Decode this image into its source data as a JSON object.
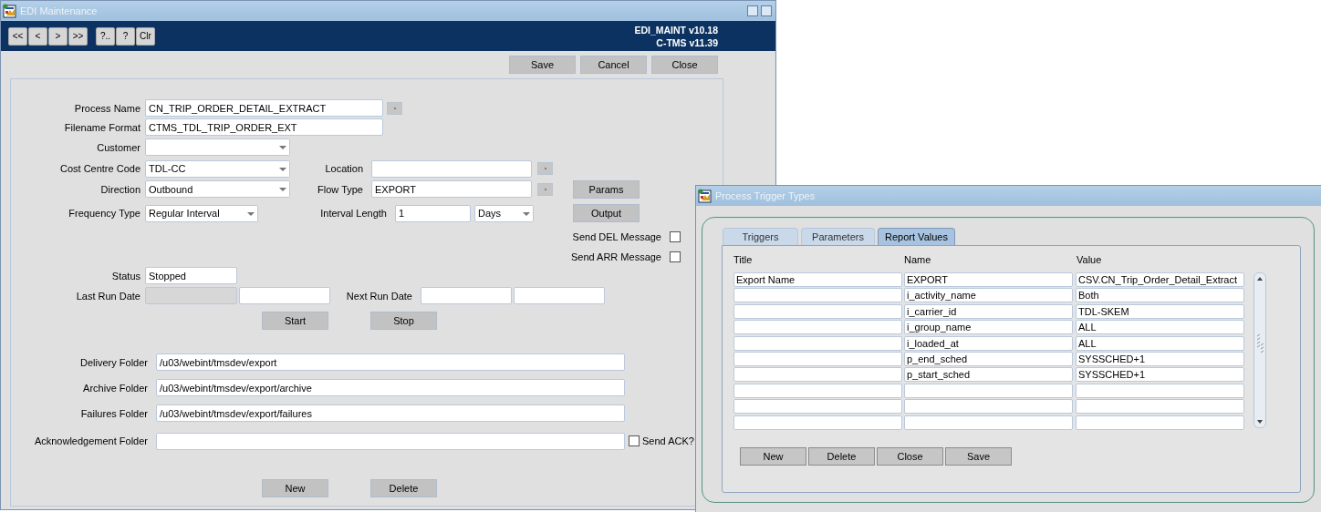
{
  "main_window": {
    "title": "EDI Maintenance",
    "toolbar_buttons": [
      "<<",
      "<",
      ">",
      ">>",
      "?..",
      "?",
      "Clr"
    ],
    "version_lines": [
      "EDI_MAINT v10.18",
      "C-TMS v11.39"
    ],
    "action_buttons": [
      "Save",
      "Cancel",
      "Close"
    ],
    "form": {
      "process_name": {
        "label": "Process Name",
        "value": "CN_TRIP_ORDER_DETAIL_EXTRACT"
      },
      "filename_format": {
        "label": "Filename Format",
        "value": "CTMS_TDL_TRIP_ORDER_EXT"
      },
      "customer": {
        "label": "Customer"
      },
      "cost_centre_code": {
        "label": "Cost Centre Code",
        "value": "TDL-CC"
      },
      "location": {
        "label": "Location"
      },
      "direction": {
        "label": "Direction",
        "value": "Outbound"
      },
      "flow_type": {
        "label": "Flow Type",
        "value": "EXPORT"
      },
      "params_button": "Params",
      "frequency_type": {
        "label": "Frequency Type",
        "value": "Regular Interval"
      },
      "interval_length": {
        "label": "Interval Length",
        "value": "1",
        "unit": "Days"
      },
      "output_button": "Output",
      "send_del_message": {
        "label": "Send DEL Message",
        "checked": false
      },
      "send_arr_message": {
        "label": "Send ARR Message",
        "checked": false
      },
      "status": {
        "label": "Status",
        "value": "Stopped"
      },
      "last_run_date": {
        "label": "Last Run Date",
        "fields": [
          {
            "disabled": true
          },
          {
            "disabled": false
          }
        ]
      },
      "next_run_date": {
        "label": "Next Run Date"
      },
      "run_buttons": [
        "Start",
        "Stop"
      ],
      "delivery_folder": {
        "label": "Delivery Folder",
        "value": "/u03/webint/tmsdev/export"
      },
      "archive_folder": {
        "label": "Archive Folder",
        "value": "/u03/webint/tmsdev/export/archive"
      },
      "failures_folder": {
        "label": "Failures Folder",
        "value": "/u03/webint/tmsdev/export/failures"
      },
      "acknowledgement_folder": {
        "label": "Acknowledgement Folder"
      },
      "send_ack": {
        "label": "Send ACK?",
        "checked": false
      },
      "bottom_buttons": [
        "New",
        "Delete"
      ]
    }
  },
  "trigger_window": {
    "title": "Process Trigger Types",
    "tabs": [
      {
        "label": "Triggers",
        "selected": false
      },
      {
        "label": "Parameters",
        "selected": false
      },
      {
        "label": "Report Values",
        "selected": true
      }
    ],
    "table": {
      "columns": [
        "Title",
        "Name",
        "Value"
      ],
      "rows": [
        {
          "title": "Export Name",
          "name": "EXPORT",
          "value": "CSV.CN_Trip_Order_Detail_Extract"
        },
        {
          "name": "i_activity_name",
          "value": "Both"
        },
        {
          "name": "i_carrier_id",
          "value": "TDL-SKEM"
        },
        {
          "name": "i_group_name",
          "value": "ALL"
        },
        {
          "name": "i_loaded_at",
          "value": "ALL"
        },
        {
          "name": "p_end_sched",
          "value": "SYSSCHED+1"
        },
        {
          "name": "p_start_sched",
          "value": "SYSSCHED+1"
        },
        {},
        {},
        {}
      ]
    },
    "buttons": [
      "New",
      "Delete",
      "Close",
      "Save"
    ]
  }
}
